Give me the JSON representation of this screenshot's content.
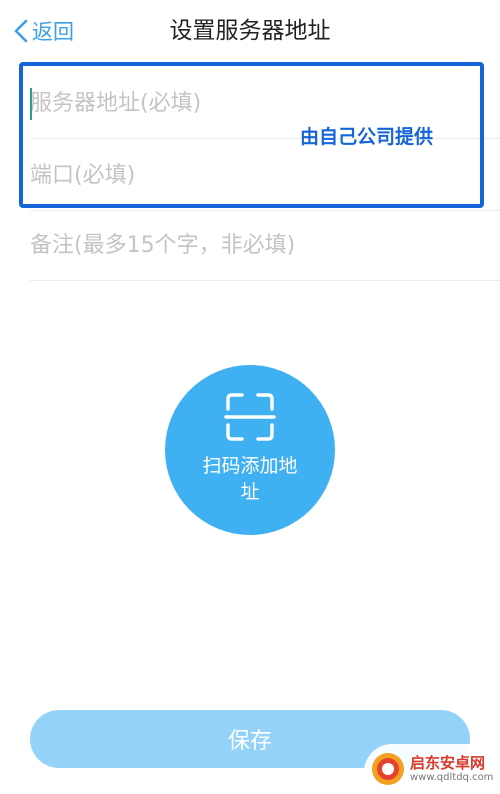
{
  "header": {
    "back_label": "返回",
    "title": "设置服务器地址"
  },
  "form": {
    "server_placeholder": "服务器地址(必填)",
    "server_value": "",
    "port_placeholder": "端口(必填)",
    "port_value": "",
    "note_placeholder": "备注(最多15个字，非必填)",
    "note_value": ""
  },
  "annotation": {
    "text": "由自己公司提供",
    "color": "#1565d8"
  },
  "scan": {
    "label": "扫码添加地址",
    "icon": "scan-frame-icon",
    "color": "#3fb0f2"
  },
  "save": {
    "label": "保存",
    "color": "#95d2fa"
  },
  "watermark": {
    "title": "启东安卓网",
    "url": "www.qdltdq.com"
  }
}
